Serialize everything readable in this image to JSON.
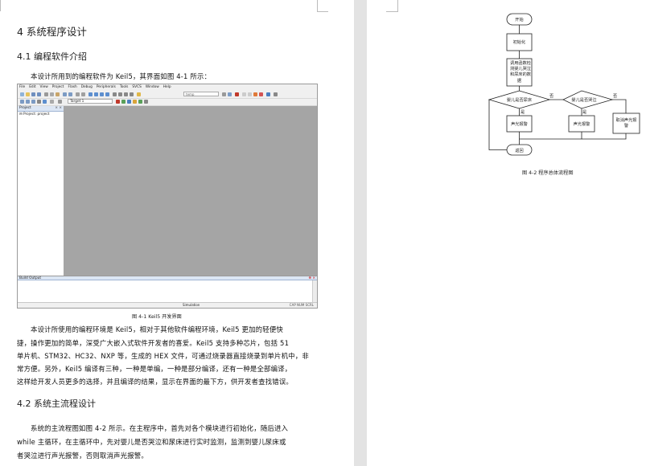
{
  "page_left": {
    "chapter_heading": "4  系统程序设计",
    "section1_heading": "4.1  编程软件介绍",
    "intro_line": "本设计所用到的编程软件为 Keil5，其界面如图 4-1 所示：",
    "ide": {
      "menu_items": [
        "File",
        "Edit",
        "View",
        "Project",
        "Flash",
        "Debug",
        "Peripherals",
        "Tools",
        "SVCS",
        "Window",
        "Help"
      ],
      "target_name": "Target 1",
      "combo_text": "temp",
      "project_panel_title": "Project",
      "project_tree_root": "Project: project",
      "build_output_title": "Build Output",
      "status_simulation": "Simulation",
      "status_caps": "CAP  NUM  SCRL"
    },
    "figure1_caption": "图 4-1  Keil5 开发界面",
    "paragraph1_lines": [
      "本设计所使用的编程环境是 Keil5，相对于其他软件编程环境，Keil5 更加的轻便快",
      "捷，操作更加的简单，深受广大嵌入式软件开发者的喜爱。Keil5 支持多种芯片，包括 51",
      "单片机、STM32、HC32、NXP 等，生成的 HEX 文件，可通过烧录器直接烧录到单片机中，非",
      "常方便。另外，Keil5 编译有三种，一种是单编，一种是部分编译，还有一种是全部编译，",
      "这样给开发人员更多的选择，并且编译的结果，显示在界面的最下方，供开发者查找错误。"
    ],
    "section2_heading": "4.2  系统主流程设计",
    "paragraph2_lines": [
      "系统的主流程图如图 4-2 所示。在主程序中，首先对各个模块进行初始化，随后进入",
      "while 主循环，在主循环中，先对婴儿是否哭泣和尿床进行实时监测，监测到婴儿尿床或",
      "者哭泣进行声光报警，否则取消声光报警。"
    ]
  },
  "page_right": {
    "flowchart": {
      "start": "开始",
      "init": "初始化",
      "call_lines": [
        "调用函数检",
        "测婴儿哭泣",
        "和尿床的数",
        "据"
      ],
      "decision1_label": "婴儿是否尿床",
      "decision2_label": "婴儿是否哭泣",
      "yes_label": "是",
      "no_label": "否",
      "alarm1": "声光报警",
      "alarm2": "声光报警",
      "cancel_lines": [
        "取消声光报",
        "警"
      ],
      "return": "返回"
    },
    "figure2_caption": "图 4-2  程序总体流程图"
  }
}
